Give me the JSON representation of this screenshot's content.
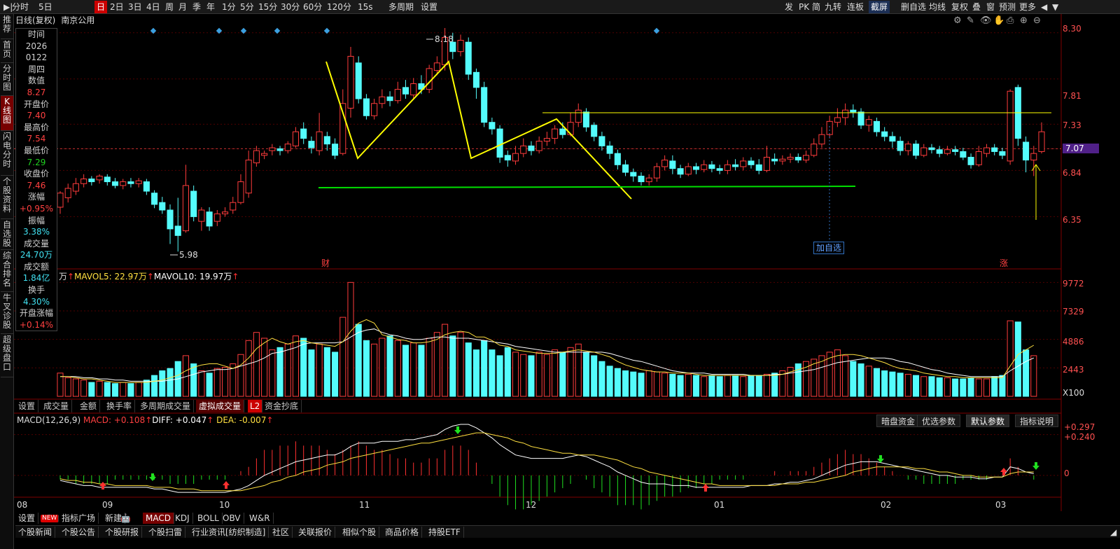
{
  "topbar": {
    "left": [
      "分时",
      "5日",
      "日",
      "2日",
      "3日",
      "4日",
      "周",
      "月",
      "季",
      "年",
      "1分",
      "5分",
      "15分",
      "30分",
      "60分",
      "120分",
      "15s",
      "多周期",
      "设置"
    ],
    "selected": "日",
    "right": [
      "发",
      "PK",
      "简",
      "九转",
      "连板",
      "截屏",
      "删自选",
      "均线",
      "复权",
      "叠",
      "窗",
      "预测",
      "更多"
    ],
    "highlight": "截屏"
  },
  "leftnav": [
    "推荐",
    "首页",
    "分时图",
    "K线图",
    "闪电分时",
    "个股资料",
    "自选股",
    "综合排名",
    "牛叉诊股",
    "超级盘口"
  ],
  "leftnav_active": "K线图",
  "chart_title": {
    "mode": "日线(复权)",
    "name": "南京公用"
  },
  "info_panel": [
    {
      "label": "时间",
      "values": [
        "2026",
        "0122",
        "周四"
      ],
      "color": "l"
    },
    {
      "label": "数值",
      "values": [
        "8.27"
      ],
      "color": "r"
    },
    {
      "label": "开盘价",
      "values": [
        "7.40"
      ],
      "color": "r"
    },
    {
      "label": "最高价",
      "values": [
        "7.54"
      ],
      "color": "r"
    },
    {
      "label": "最低价",
      "values": [
        "7.29"
      ],
      "color": "g"
    },
    {
      "label": "收盘价",
      "values": [
        "7.46"
      ],
      "color": "r"
    },
    {
      "label": "涨幅",
      "values": [
        "+0.95%"
      ],
      "color": "r"
    },
    {
      "label": "振幅",
      "values": [
        "3.38%"
      ],
      "color": "c"
    },
    {
      "label": "成交量",
      "values": [
        "24.70万"
      ],
      "color": "c"
    },
    {
      "label": "成交额",
      "values": [
        "1.84亿"
      ],
      "color": "c"
    },
    {
      "label": "换手",
      "values": [
        "4.30%"
      ],
      "color": "c"
    },
    {
      "label": "开盘涨幅",
      "values": [
        "+0.14%"
      ],
      "color": "r"
    }
  ],
  "price_axis": {
    "labels": [
      "8.30",
      "7.81",
      "7.33",
      "7.07",
      "6.84",
      "6.35"
    ],
    "current": "7.07"
  },
  "price_annotations": {
    "high": "8.18",
    "low": "5.98",
    "fin_mark": "财",
    "up_mark": "涨",
    "add_watch": "加自选"
  },
  "volume_legend": {
    "unit": "万",
    "mavol5": "MAVOL5: 22.97万",
    "mavol10": "MAVOL10: 19.97万"
  },
  "volume_axis": [
    "9772",
    "7329",
    "4886",
    "2443",
    "X100"
  ],
  "volume_tabs": [
    "设置",
    "成交量",
    "金额",
    "换手率",
    "多周期成交量",
    "虚拟成交量",
    "L2",
    "资金抄底"
  ],
  "volume_tab_selected": "虚拟成交量",
  "macd_legend": {
    "name": "MACD(12,26,9)",
    "macd": "MACD: +0.108",
    "diff": "DIFF: +0.047",
    "dea": "DEA: -0.007"
  },
  "macd_axis": [
    "+0.297",
    "+0.240",
    "0"
  ],
  "macd_buttons": [
    "暗盘资金",
    "优选参数",
    "默认参数",
    "指标说明"
  ],
  "macd_button_selected": "默认参数",
  "months": [
    "08",
    "09",
    "10",
    "11",
    "12",
    "01",
    "02",
    "03"
  ],
  "indicator_tabs": [
    "设置",
    "NEW",
    "指标广场",
    "新建",
    "MACD",
    "KDJ",
    "BOLL",
    "OBV",
    "W&R"
  ],
  "indicator_selected": "MACD",
  "bottom_tabs": [
    "个股新闻",
    "个股公告",
    "个股研报",
    "个股扫雷",
    "行业资讯[纺织制造]",
    "社区",
    "关联报价",
    "相似个股",
    "商品价格",
    "持股ETF"
  ],
  "colors": {
    "up": "#ff3c3c",
    "down": "#54fcfc",
    "ma5": "#ffffff",
    "ma10": "#ffe040",
    "trend": "#ffff00",
    "support": "#00e000"
  },
  "chart_data": {
    "type": "candlestick",
    "price_range": [
      5.9,
      8.35
    ],
    "candles": [
      [
        6.45,
        6.6,
        6.62,
        6.38
      ],
      [
        6.55,
        6.65,
        6.7,
        6.5
      ],
      [
        6.62,
        6.7,
        6.76,
        6.58
      ],
      [
        6.7,
        6.75,
        6.8,
        6.66
      ],
      [
        6.75,
        6.72,
        6.78,
        6.68
      ],
      [
        6.74,
        6.78,
        6.8,
        6.7
      ],
      [
        6.77,
        6.72,
        6.8,
        6.68
      ],
      [
        6.72,
        6.68,
        6.76,
        6.65
      ],
      [
        6.68,
        6.72,
        6.75,
        6.64
      ],
      [
        6.72,
        6.7,
        6.76,
        6.66
      ],
      [
        6.7,
        6.73,
        6.76,
        6.66
      ],
      [
        6.72,
        6.62,
        6.75,
        6.58
      ],
      [
        6.6,
        6.48,
        6.63,
        6.44
      ],
      [
        6.5,
        6.42,
        6.56,
        6.38
      ],
      [
        6.42,
        6.22,
        6.48,
        6.06
      ],
      [
        6.25,
        6.15,
        6.55,
        5.98
      ],
      [
        6.2,
        6.68,
        6.9,
        6.18
      ],
      [
        6.62,
        6.35,
        6.68,
        6.3
      ],
      [
        6.3,
        6.42,
        6.45,
        6.2
      ],
      [
        6.4,
        6.25,
        6.45,
        6.2
      ],
      [
        6.3,
        6.38,
        6.42,
        6.25
      ],
      [
        6.38,
        6.4,
        6.45,
        6.35
      ],
      [
        6.42,
        6.5,
        6.56,
        6.38
      ],
      [
        6.5,
        6.72,
        6.8,
        6.48
      ],
      [
        6.6,
        6.95,
        7.05,
        6.55
      ],
      [
        6.92,
        7.05,
        7.1,
        6.88
      ],
      [
        7.0,
        7.02,
        7.05,
        6.96
      ],
      [
        7.05,
        7.08,
        7.12,
        7.0
      ],
      [
        7.07,
        7.05,
        7.1,
        7.0
      ],
      [
        7.05,
        7.12,
        7.15,
        7.02
      ],
      [
        7.1,
        7.25,
        7.3,
        7.08
      ],
      [
        7.28,
        7.18,
        7.35,
        7.12
      ],
      [
        7.15,
        7.08,
        7.2,
        7.02
      ],
      [
        7.05,
        7.25,
        7.45,
        7.0
      ],
      [
        7.2,
        7.12,
        7.25,
        7.05
      ],
      [
        7.12,
        7.0,
        7.18,
        6.96
      ],
      [
        7.02,
        7.55,
        7.7,
        7.0
      ],
      [
        7.5,
        8.05,
        8.15,
        7.4
      ],
      [
        7.98,
        7.6,
        8.05,
        7.55
      ],
      [
        7.6,
        7.42,
        7.65,
        7.38
      ],
      [
        7.42,
        7.55,
        7.6,
        7.38
      ],
      [
        7.55,
        7.62,
        7.7,
        7.5
      ],
      [
        7.62,
        7.58,
        7.68,
        7.52
      ],
      [
        7.58,
        7.7,
        7.78,
        7.55
      ],
      [
        7.72,
        7.65,
        7.8,
        7.6
      ],
      [
        7.64,
        7.76,
        7.82,
        7.6
      ],
      [
        7.76,
        7.7,
        7.85,
        7.65
      ],
      [
        7.7,
        7.92,
        7.96,
        7.66
      ],
      [
        7.9,
        7.98,
        8.05,
        7.85
      ],
      [
        7.96,
        8.25,
        8.35,
        7.9
      ],
      [
        8.2,
        8.1,
        8.3,
        8.02
      ],
      [
        8.1,
        8.22,
        8.28,
        8.05
      ],
      [
        8.2,
        7.86,
        8.25,
        7.8
      ],
      [
        7.88,
        7.72,
        7.92,
        7.6
      ],
      [
        7.72,
        7.35,
        7.78,
        7.3
      ],
      [
        7.35,
        7.28,
        7.4,
        7.22
      ],
      [
        7.28,
        6.98,
        7.32,
        6.92
      ],
      [
        7.0,
        6.95,
        7.05,
        6.88
      ],
      [
        6.94,
        7.02,
        7.1,
        6.9
      ],
      [
        7.02,
        7.1,
        7.18,
        6.98
      ],
      [
        7.1,
        7.05,
        7.15,
        7.0
      ],
      [
        7.05,
        7.15,
        7.2,
        7.02
      ],
      [
        7.15,
        7.18,
        7.25,
        7.1
      ],
      [
        7.18,
        7.28,
        7.32,
        7.12
      ],
      [
        7.28,
        7.22,
        7.35,
        7.18
      ],
      [
        7.22,
        7.35,
        7.45,
        7.2
      ],
      [
        7.35,
        7.48,
        7.55,
        7.3
      ],
      [
        7.46,
        7.3,
        7.5,
        7.25
      ],
      [
        7.32,
        7.2,
        7.35,
        7.15
      ],
      [
        7.2,
        7.1,
        7.25,
        7.05
      ],
      [
        7.1,
        7.02,
        7.15,
        6.96
      ],
      [
        7.02,
        6.9,
        7.06,
        6.85
      ],
      [
        6.9,
        6.82,
        6.95,
        6.78
      ],
      [
        6.82,
        6.78,
        6.86,
        6.72
      ],
      [
        6.78,
        6.72,
        6.82,
        6.68
      ],
      [
        6.72,
        6.76,
        6.8,
        6.68
      ],
      [
        6.76,
        6.88,
        6.92,
        6.72
      ],
      [
        6.88,
        6.95,
        7.0,
        6.84
      ],
      [
        6.94,
        6.86,
        7.0,
        6.8
      ],
      [
        6.86,
        6.8,
        6.9,
        6.76
      ],
      [
        6.8,
        6.88,
        6.92,
        6.78
      ],
      [
        6.88,
        6.85,
        6.92,
        6.8
      ],
      [
        6.85,
        6.9,
        6.95,
        6.82
      ],
      [
        6.9,
        6.86,
        6.94,
        6.82
      ],
      [
        6.86,
        6.84,
        6.9,
        6.8
      ],
      [
        6.84,
        6.9,
        6.95,
        6.8
      ],
      [
        6.9,
        6.88,
        6.96,
        6.84
      ],
      [
        6.88,
        6.94,
        6.98,
        6.84
      ],
      [
        6.94,
        6.9,
        6.98,
        6.86
      ],
      [
        6.9,
        6.84,
        6.96,
        6.8
      ],
      [
        6.84,
        6.98,
        7.1,
        6.82
      ],
      [
        6.96,
        6.94,
        7.02,
        6.9
      ],
      [
        6.94,
        6.96,
        7.0,
        6.9
      ],
      [
        6.96,
        6.98,
        7.02,
        6.92
      ],
      [
        6.98,
        6.95,
        7.02,
        6.92
      ],
      [
        6.95,
        7.0,
        7.05,
        6.92
      ],
      [
        7.0,
        7.12,
        7.18,
        6.98
      ],
      [
        7.12,
        7.22,
        7.3,
        7.08
      ],
      [
        7.22,
        7.36,
        7.42,
        7.18
      ],
      [
        7.35,
        7.4,
        7.5,
        7.3
      ],
      [
        7.4,
        7.48,
        7.55,
        7.32
      ],
      [
        7.48,
        7.46,
        7.54,
        7.4
      ],
      [
        7.46,
        7.32,
        7.5,
        7.28
      ],
      [
        7.32,
        7.38,
        7.42,
        7.25
      ],
      [
        7.36,
        7.25,
        7.4,
        7.2
      ],
      [
        7.25,
        7.2,
        7.3,
        7.15
      ],
      [
        7.2,
        7.15,
        7.25,
        7.08
      ],
      [
        7.15,
        7.05,
        7.2,
        7.0
      ],
      [
        7.05,
        7.12,
        7.15,
        7.0
      ],
      [
        7.12,
        7.0,
        7.16,
        6.96
      ],
      [
        7.0,
        7.08,
        7.12,
        6.98
      ],
      [
        7.08,
        7.06,
        7.12,
        7.02
      ],
      [
        7.06,
        7.02,
        7.1,
        6.98
      ],
      [
        7.02,
        7.06,
        7.1,
        7.0
      ],
      [
        7.06,
        7.04,
        7.1,
        7.0
      ],
      [
        7.04,
        6.98,
        7.08,
        6.95
      ],
      [
        6.98,
        6.9,
        7.02,
        6.86
      ],
      [
        6.9,
        7.04,
        7.1,
        6.88
      ],
      [
        7.02,
        7.08,
        7.12,
        6.98
      ],
      [
        7.08,
        7.04,
        7.12,
        7.0
      ],
      [
        7.04,
        7.0,
        7.08,
        6.96
      ],
      [
        6.94,
        7.68,
        7.7,
        6.9
      ],
      [
        7.72,
        7.18,
        7.75,
        7.1
      ],
      [
        7.14,
        6.95,
        7.2,
        6.82
      ],
      [
        6.95,
        7.02,
        7.1,
        6.78
      ],
      [
        7.04,
        7.25,
        7.35,
        7.02
      ]
    ],
    "volume": [
      20,
      16,
      15,
      14,
      12,
      13,
      12,
      11,
      12,
      11,
      12,
      14,
      18,
      22,
      24,
      30,
      35,
      28,
      22,
      20,
      24,
      25,
      28,
      36,
      48,
      55,
      50,
      40,
      42,
      45,
      52,
      50,
      40,
      45,
      42,
      38,
      68,
      98,
      62,
      48,
      45,
      50,
      52,
      48,
      44,
      46,
      44,
      50,
      55,
      62,
      52,
      55,
      46,
      40,
      48,
      40,
      35,
      42,
      38,
      36,
      35,
      38,
      36,
      40,
      38,
      42,
      45,
      38,
      35,
      30,
      26,
      24,
      22,
      21,
      20,
      22,
      21,
      20,
      19,
      18,
      19,
      18,
      17,
      18,
      17,
      18,
      18,
      17,
      18,
      18,
      19,
      20,
      22,
      25,
      28,
      30,
      32,
      35,
      38,
      40,
      35,
      30,
      28,
      26,
      24,
      22,
      21,
      20,
      19,
      18,
      17,
      17,
      16,
      16,
      15,
      15,
      16,
      15,
      15,
      17,
      18,
      65,
      64,
      40,
      35
    ],
    "ma5": [
      17,
      17,
      16,
      15,
      15,
      14,
      13,
      12,
      12,
      12,
      12,
      12,
      13,
      14,
      16,
      18,
      22,
      25,
      27,
      28,
      28,
      26,
      24,
      27,
      33,
      41,
      46,
      50,
      47,
      45,
      47,
      48,
      46,
      45,
      44,
      43,
      47,
      56,
      63,
      66,
      63,
      53,
      51,
      49,
      48,
      46,
      46,
      47,
      49,
      53,
      55,
      56,
      55,
      51,
      51,
      48,
      44,
      43,
      40,
      39,
      38,
      37,
      37,
      37,
      38,
      39,
      40,
      39,
      38,
      36,
      34,
      30,
      27,
      25,
      23,
      22,
      21,
      21,
      20,
      20,
      20,
      19,
      18,
      18,
      18,
      18,
      18,
      18,
      18,
      18,
      18,
      18,
      19,
      21,
      23,
      25,
      28,
      30,
      33,
      35,
      36,
      36,
      35,
      33,
      31,
      29,
      26,
      24,
      23,
      22,
      20,
      19,
      18,
      17,
      17,
      16,
      16,
      16,
      16,
      16,
      16,
      26,
      36,
      40,
      44
    ],
    "ma10": [
      17,
      17,
      17,
      16,
      16,
      15,
      15,
      14,
      14,
      13,
      13,
      13,
      13,
      13,
      14,
      15,
      17,
      19,
      21,
      22,
      23,
      23,
      24,
      26,
      28,
      30,
      33,
      37,
      38,
      40,
      42,
      45,
      46,
      46,
      46,
      46,
      47,
      51,
      55,
      57,
      58,
      55,
      53,
      52,
      50,
      49,
      49,
      50,
      51,
      51,
      50,
      50,
      50,
      49,
      48,
      47,
      46,
      45,
      43,
      42,
      41,
      40,
      39,
      38,
      38,
      38,
      38,
      38,
      38,
      38,
      37,
      35,
      33,
      31,
      30,
      28,
      26,
      24,
      22,
      21,
      20,
      20,
      20,
      19,
      19,
      19,
      19,
      19,
      18,
      18,
      18,
      19,
      19,
      20,
      21,
      22,
      23,
      25,
      27,
      29,
      30,
      31,
      32,
      33,
      33,
      33,
      32,
      30,
      29,
      27,
      25,
      23,
      22,
      20,
      19,
      18,
      17,
      17,
      17,
      17,
      17,
      22,
      26,
      30,
      33
    ],
    "macd_diff": [
      -0.03,
      -0.04,
      -0.05,
      -0.06,
      -0.06,
      -0.07,
      -0.07,
      -0.07,
      -0.07,
      -0.07,
      -0.07,
      -0.07,
      -0.08,
      -0.08,
      -0.09,
      -0.1,
      -0.1,
      -0.1,
      -0.1,
      -0.1,
      -0.1,
      -0.1,
      -0.09,
      -0.08,
      -0.06,
      -0.03,
      0.0,
      0.02,
      0.04,
      0.06,
      0.08,
      0.09,
      0.1,
      0.11,
      0.12,
      0.12,
      0.14,
      0.17,
      0.19,
      0.19,
      0.19,
      0.2,
      0.2,
      0.2,
      0.21,
      0.21,
      0.22,
      0.23,
      0.24,
      0.27,
      0.29,
      0.3,
      0.3,
      0.28,
      0.25,
      0.22,
      0.18,
      0.15,
      0.12,
      0.11,
      0.1,
      0.1,
      0.1,
      0.1,
      0.1,
      0.11,
      0.12,
      0.11,
      0.09,
      0.07,
      0.05,
      0.02,
      0.0,
      -0.02,
      -0.04,
      -0.05,
      -0.05,
      -0.05,
      -0.06,
      -0.06,
      -0.06,
      -0.07,
      -0.07,
      -0.07,
      -0.07,
      -0.07,
      -0.07,
      -0.07,
      -0.06,
      -0.06,
      -0.06,
      -0.05,
      -0.05,
      -0.04,
      -0.04,
      -0.03,
      -0.02,
      0.0,
      0.02,
      0.04,
      0.06,
      0.07,
      0.08,
      0.08,
      0.08,
      0.07,
      0.06,
      0.05,
      0.04,
      0.03,
      0.02,
      0.01,
      0.0,
      0.0,
      -0.01,
      -0.01,
      -0.01,
      -0.02,
      -0.02,
      -0.01,
      -0.01,
      0.05,
      0.04,
      0.02,
      0.01
    ],
    "macd_dea": [
      -0.02,
      -0.03,
      -0.03,
      -0.04,
      -0.04,
      -0.05,
      -0.05,
      -0.06,
      -0.06,
      -0.06,
      -0.06,
      -0.06,
      -0.07,
      -0.07,
      -0.07,
      -0.08,
      -0.08,
      -0.08,
      -0.09,
      -0.09,
      -0.09,
      -0.09,
      -0.09,
      -0.09,
      -0.08,
      -0.07,
      -0.06,
      -0.04,
      -0.03,
      -0.01,
      0.0,
      0.02,
      0.03,
      0.04,
      0.06,
      0.07,
      0.08,
      0.1,
      0.11,
      0.12,
      0.13,
      0.14,
      0.15,
      0.16,
      0.17,
      0.18,
      0.19,
      0.19,
      0.2,
      0.21,
      0.22,
      0.23,
      0.24,
      0.25,
      0.25,
      0.24,
      0.23,
      0.22,
      0.2,
      0.19,
      0.17,
      0.16,
      0.15,
      0.14,
      0.13,
      0.13,
      0.12,
      0.12,
      0.12,
      0.11,
      0.1,
      0.09,
      0.07,
      0.05,
      0.04,
      0.02,
      0.01,
      0.0,
      -0.01,
      -0.02,
      -0.03,
      -0.04,
      -0.05,
      -0.05,
      -0.06,
      -0.06,
      -0.06,
      -0.06,
      -0.06,
      -0.06,
      -0.06,
      -0.06,
      -0.05,
      -0.05,
      -0.05,
      -0.04,
      -0.04,
      -0.03,
      -0.02,
      -0.01,
      0.0,
      0.02,
      0.03,
      0.04,
      0.05,
      0.05,
      0.05,
      0.05,
      0.05,
      0.04,
      0.04,
      0.03,
      0.02,
      0.02,
      0.01,
      0.0,
      0.0,
      -0.01,
      -0.01,
      -0.01,
      -0.01,
      0.01,
      0.02,
      0.02,
      0.02
    ],
    "macd_range": [
      -0.12,
      0.3
    ]
  }
}
